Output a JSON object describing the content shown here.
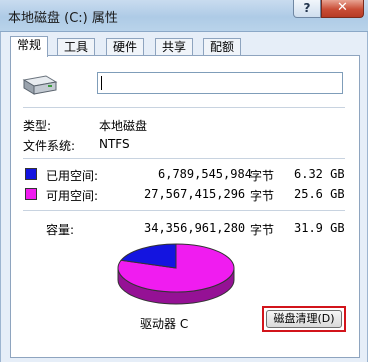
{
  "window": {
    "title": "本地磁盘 (C:) 属性",
    "help_label": "?",
    "close_label": "✕"
  },
  "tabs": [
    {
      "label": "常规",
      "active": true
    },
    {
      "label": "工具",
      "active": false
    },
    {
      "label": "硬件",
      "active": false
    },
    {
      "label": "共享",
      "active": false
    },
    {
      "label": "配额",
      "active": false
    }
  ],
  "general": {
    "icon": "hard-drive-icon",
    "name_value": "",
    "type_label": "类型:",
    "type_value": "本地磁盘",
    "fs_label": "文件系统:",
    "fs_value": "NTFS",
    "used": {
      "label": "已用空间:",
      "bytes": "6,789,545,984",
      "unit": "字节",
      "size": "6.32 GB",
      "color": "#1414e0"
    },
    "free": {
      "label": "可用空间:",
      "bytes": "27,567,415,296",
      "unit": "字节",
      "size": "25.6 GB",
      "color": "#f01cf0"
    },
    "capacity": {
      "label": "容量:",
      "bytes": "34,356,961,280",
      "unit": "字节",
      "size": "31.9 GB"
    },
    "used_fraction": 0.198,
    "drive_label": "驱动器 C",
    "cleanup_label": "磁盘清理(D)"
  }
}
